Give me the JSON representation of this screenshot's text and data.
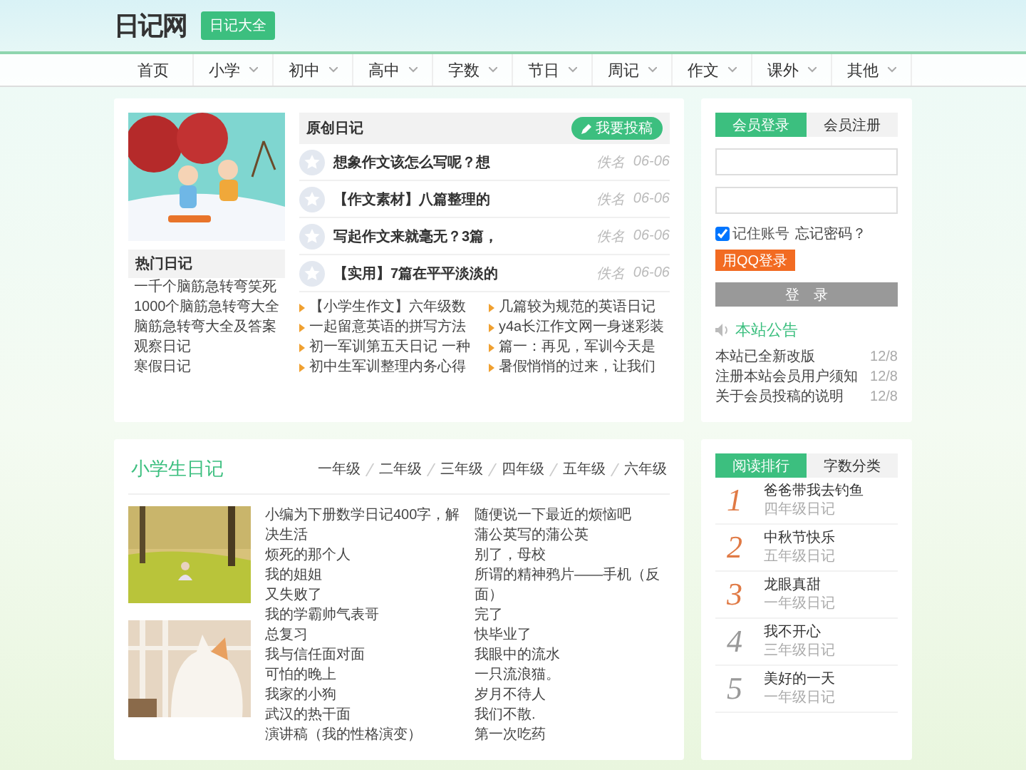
{
  "header": {
    "logo": "日记网",
    "badge": "日记大全"
  },
  "nav": [
    {
      "label": "首页",
      "dropdown": false
    },
    {
      "label": "小学",
      "dropdown": true
    },
    {
      "label": "初中",
      "dropdown": true
    },
    {
      "label": "高中",
      "dropdown": true
    },
    {
      "label": "字数",
      "dropdown": true
    },
    {
      "label": "节日",
      "dropdown": true
    },
    {
      "label": "周记",
      "dropdown": true
    },
    {
      "label": "作文",
      "dropdown": true
    },
    {
      "label": "课外",
      "dropdown": true
    },
    {
      "label": "其他",
      "dropdown": true
    }
  ],
  "featured": {
    "picture": {
      "kind": "picture"
    },
    "hot_title": "热门日记",
    "hot_items": [
      "一千个脑筋急转弯笑死",
      "1000个脑筋急转弯大全",
      "脑筋急转弯大全及答案",
      "观察日记",
      "寒假日记"
    ]
  },
  "original": {
    "title": "原创日记",
    "submit_button": "我要投稿",
    "posts": [
      {
        "title": "想象作文该怎么写呢？想",
        "author": "佚名",
        "date": "06-06"
      },
      {
        "title": "【作文素材】八篇整理的",
        "author": "佚名",
        "date": "06-06"
      },
      {
        "title": "写起作文来就毫无？3篇，",
        "author": "佚名",
        "date": "06-06"
      },
      {
        "title": "【实用】7篇在平平淡淡的",
        "author": "佚名",
        "date": "06-06"
      }
    ],
    "links": [
      "【小学生作文】六年级数",
      "几篇较为规范的英语日记",
      "一起留意英语的拼写方法",
      "y4a长江作文网一身迷彩装",
      "初一军训第五天日记 一种",
      "篇一：再见，军训今天是",
      "初中生军训整理内务心得",
      "暑假悄悄的过来，让我们"
    ]
  },
  "login": {
    "tabs": [
      {
        "label": "会员登录",
        "selected": true
      },
      {
        "label": "会员注册",
        "selected": false
      }
    ],
    "remember": {
      "label": "记住账号",
      "checked": true
    },
    "forgot": "忘记密码？",
    "qq_button": "用QQ登录",
    "submit_button": "登　录"
  },
  "notices": {
    "title": "本站公告",
    "items": [
      {
        "text": "本站已全新改版",
        "date": "12/8"
      },
      {
        "text": "注册本站会员用户须知",
        "date": "12/8"
      },
      {
        "text": "关于会员投稿的说明",
        "date": "12/8"
      }
    ]
  },
  "primary": {
    "title": "小学生日记",
    "grades": [
      "一年级",
      "二年级",
      "三年级",
      "四年级",
      "五年级",
      "六年级"
    ],
    "pictures": [
      {
        "kind": "picture"
      },
      {
        "kind": "picture"
      }
    ],
    "column_1": [
      "小编为下册数学日记400字，解决生活",
      "烦死的那个人",
      "我的姐姐",
      "又失败了",
      "我的学霸帅气表哥",
      "总复习",
      "我与信任面对面",
      "可怕的晚上",
      "我家的小狗",
      "武汉的热干面",
      "演讲稿（我的性格演变）"
    ],
    "column_2": [
      "随便说一下最近的烦恼吧",
      "蒲公英写的蒲公英",
      "别了，母校",
      "所谓的精神鸦片——手机（反面）",
      "完了",
      "快毕业了",
      "我眼中的流水",
      "一只流浪猫。",
      "岁月不待人",
      "我们不散.",
      "第一次吃药"
    ]
  },
  "ranking": {
    "tabs": [
      {
        "label": "阅读排行",
        "selected": true
      },
      {
        "label": "字数分类",
        "selected": false
      }
    ],
    "items": [
      {
        "rank": "1",
        "title": "爸爸带我去钓鱼",
        "category": "四年级日记",
        "highlighted": true
      },
      {
        "rank": "2",
        "title": "中秋节快乐",
        "category": "五年级日记",
        "highlighted": true
      },
      {
        "rank": "3",
        "title": "龙眼真甜",
        "category": "一年级日记",
        "highlighted": true
      },
      {
        "rank": "4",
        "title": "我不开心",
        "category": "三年级日记",
        "highlighted": false
      },
      {
        "rank": "5",
        "title": "美好的一天",
        "category": "一年级日记",
        "highlighted": false
      }
    ]
  }
}
